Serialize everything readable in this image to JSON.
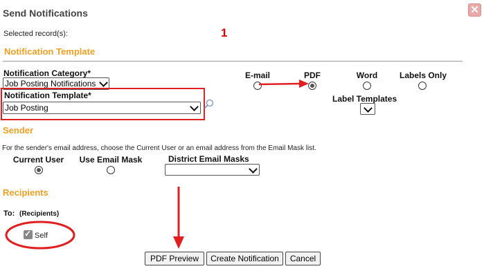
{
  "dialog": {
    "title": "Send Notifications",
    "close_glyph": "✕"
  },
  "selected": {
    "label": "Selected record(s):",
    "count": "1"
  },
  "notification_template_section": {
    "heading": "Notification Template",
    "category_label": "Notification Category*",
    "category_value": "Job Posting Notifications",
    "template_label": "Notification Template*",
    "template_value": "Job Posting",
    "search_icon": "magnifier-icon"
  },
  "output_format": {
    "options": [
      {
        "label": "E-mail",
        "selected": false
      },
      {
        "label": "PDF",
        "selected": true
      },
      {
        "label": "Word",
        "selected": false
      },
      {
        "label": "Labels Only",
        "selected": false
      }
    ],
    "label_templates_label": "Label Templates",
    "label_templates_value": ""
  },
  "sender": {
    "heading": "Sender",
    "instructions": "For the sender's email address, choose the Current User or an email address from the Email Mask list.",
    "options": [
      {
        "label": "Current User",
        "selected": true
      },
      {
        "label": "Use Email Mask",
        "selected": false
      }
    ],
    "district_masks_label": "District Email Masks",
    "district_masks_value": ""
  },
  "recipients": {
    "heading": "Recipients",
    "to_label": "To:",
    "to_hint": "(Recipients)",
    "self_label": "Self",
    "self_checked": true
  },
  "actions": {
    "pdf_preview": "PDF Preview",
    "create": "Create Notification",
    "cancel": "Cancel"
  },
  "annotations": {
    "color": "#e02020"
  }
}
